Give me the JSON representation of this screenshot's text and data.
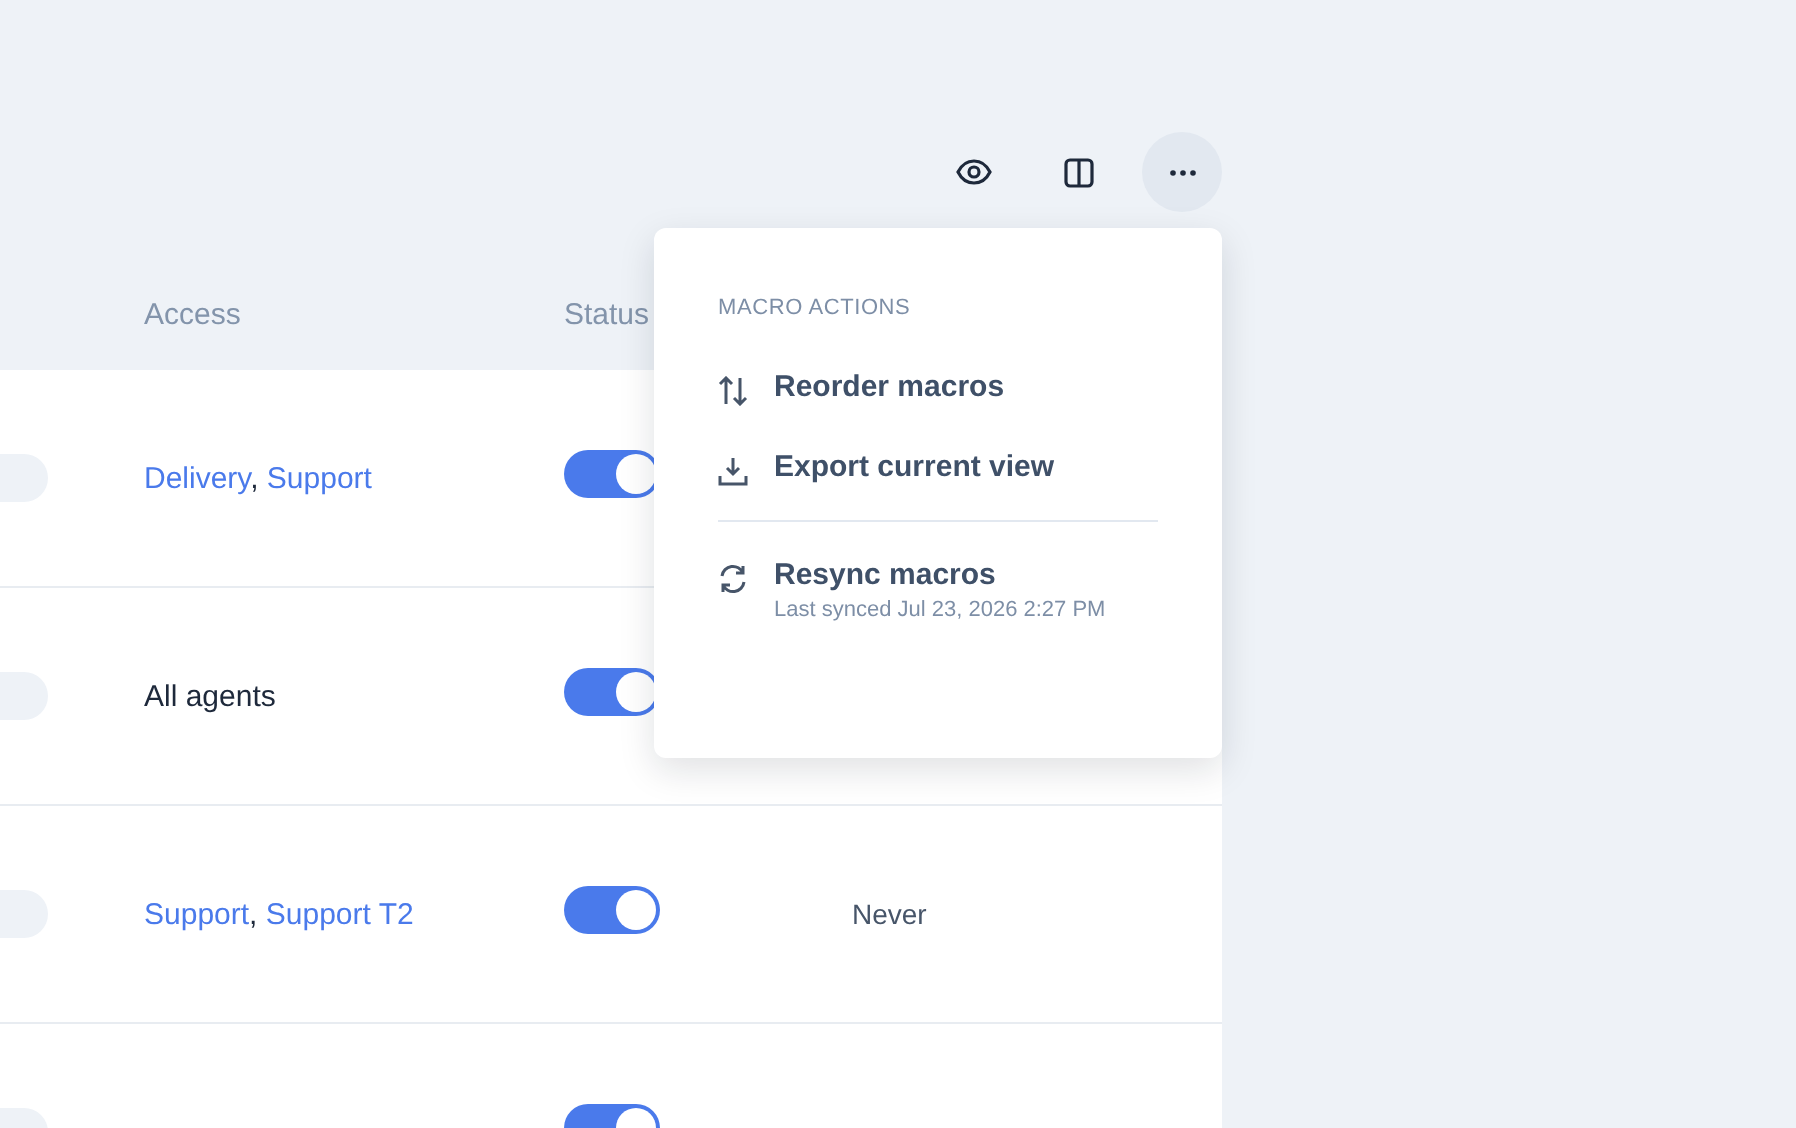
{
  "toolbar": {
    "buttons": [
      {
        "kind": "eye",
        "selected": false
      },
      {
        "kind": "columns",
        "selected": false
      },
      {
        "kind": "more",
        "selected": true
      }
    ]
  },
  "table": {
    "columns": [
      "Access",
      "Status"
    ],
    "rows": [
      {
        "access": [
          {
            "text": "Delivery",
            "kind": "link"
          },
          {
            "text": ", ",
            "kind": "plain"
          },
          {
            "text": "Support",
            "kind": "link"
          }
        ],
        "on": true
      },
      {
        "access": [
          {
            "text": "All agents",
            "kind": "plain"
          }
        ],
        "on": true
      },
      {
        "access": [
          {
            "text": "Support",
            "kind": "link"
          },
          {
            "text": ", ",
            "kind": "plain"
          },
          {
            "text": "Support T2",
            "kind": "link"
          }
        ],
        "on": true,
        "column_4": "Never"
      },
      {
        "access": [],
        "on": true
      }
    ]
  },
  "menu": {
    "heading": "MACRO ACTIONS",
    "items": [
      {
        "kind": "reorder",
        "label": "Reorder macros"
      },
      {
        "kind": "download",
        "label": "Export current view"
      },
      {
        "kind": "divider"
      },
      {
        "kind": "sync",
        "label": "Resync macros",
        "detail": "Last synced Jul 23, 2026 2:27 PM"
      }
    ]
  }
}
